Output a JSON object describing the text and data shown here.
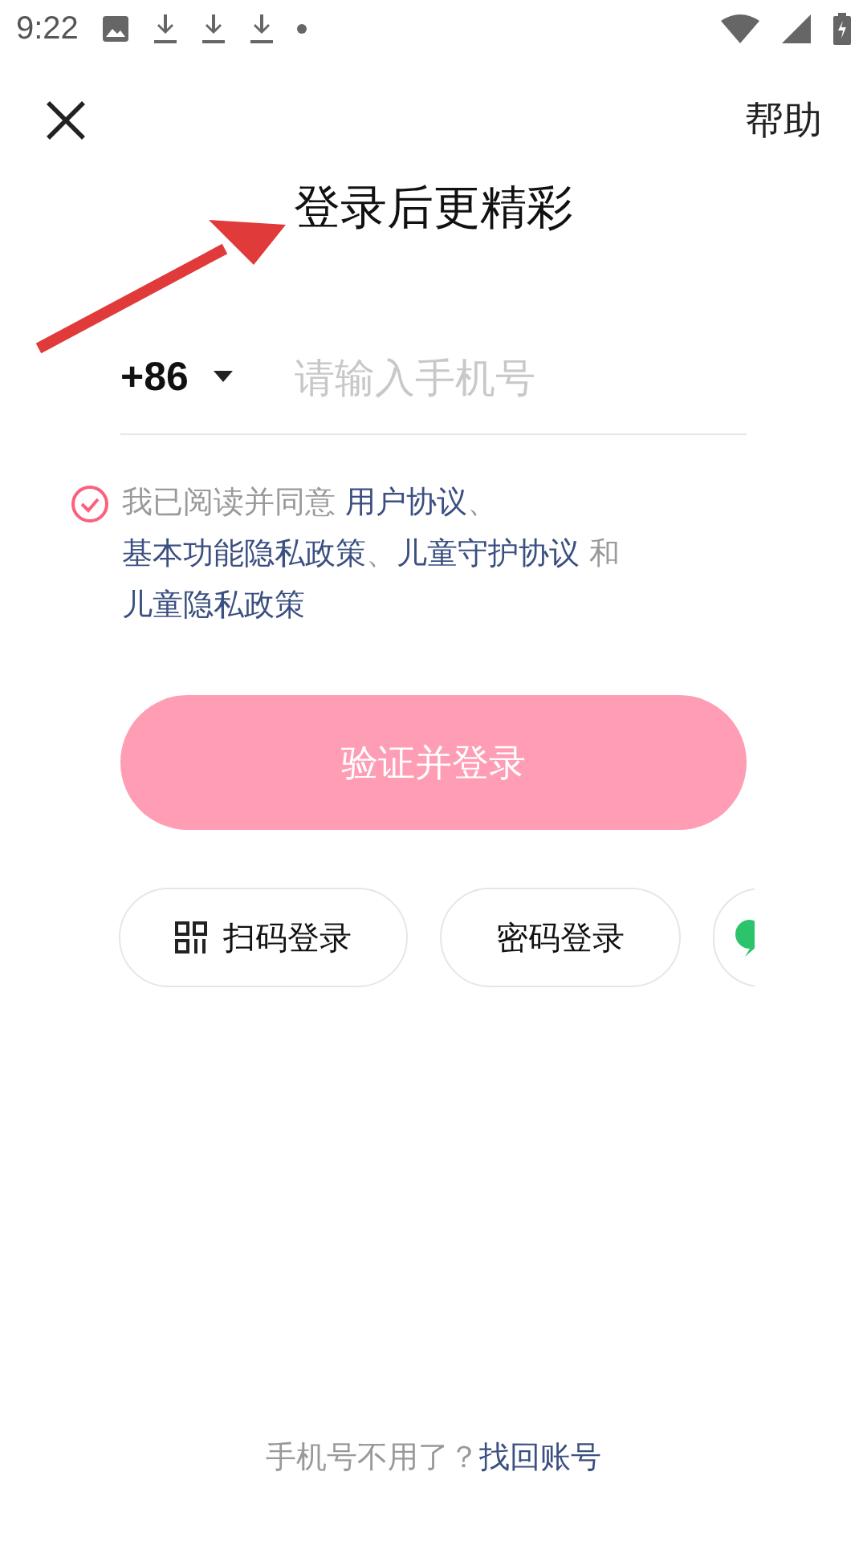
{
  "status_bar": {
    "time": "9:22"
  },
  "header": {
    "help": "帮助"
  },
  "title": "登录后更精彩",
  "phone": {
    "country_code": "+86",
    "placeholder": "请输入手机号"
  },
  "agreement": {
    "checked": true,
    "parts": [
      {
        "kind": "text",
        "text": "我已阅读并同意 "
      },
      {
        "kind": "link",
        "text": "用户协议"
      },
      {
        "kind": "text",
        "text": "、"
      },
      {
        "kind": "link",
        "text": "基本功能隐私政策"
      },
      {
        "kind": "text",
        "text": "、"
      },
      {
        "kind": "link",
        "text": "儿童守护协议"
      },
      {
        "kind": "text",
        "text": " 和 "
      },
      {
        "kind": "link",
        "text": "儿童隐私政策"
      }
    ]
  },
  "login_button": {
    "label": "验证并登录",
    "disabled": true
  },
  "alt_logins": [
    {
      "kind": "qr",
      "label": "扫码登录"
    },
    {
      "kind": "password",
      "label": "密码登录"
    },
    {
      "kind": "chat"
    }
  ],
  "footer": {
    "text": "手机号不用了？",
    "link": "找回账号"
  }
}
